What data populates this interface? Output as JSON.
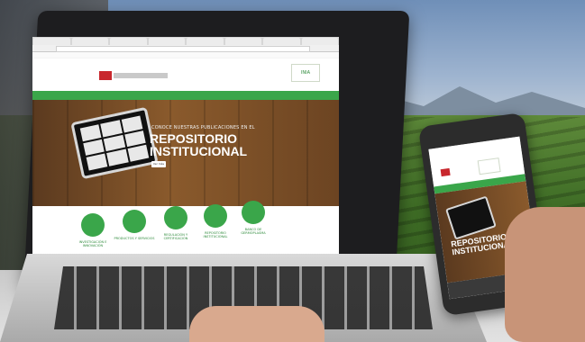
{
  "laptop_site": {
    "hero_kicker": "CONOCE NUESTRAS PUBLICACIONES EN EL",
    "hero_title_line1": "REPOSITORIO",
    "hero_title_line2": "INSTITUCIONAL",
    "hero_button": "Ver más",
    "header_logo_right": "INIA",
    "icons": [
      {
        "label": "INVESTIGACIÓN E INNOVACIÓN"
      },
      {
        "label": "PRODUCTOS Y SERVICIOS"
      },
      {
        "label": "REGULACIÓN Y CERTIFICACIÓN"
      },
      {
        "label": "REPOSITORIO INSTITUCIONAL"
      },
      {
        "label": "BANCO DE GERMOPLASMA"
      }
    ]
  },
  "phone_site": {
    "hero_title_line1": "REPOSITORIO",
    "hero_title_line2": "INSTITUCIONAL"
  },
  "colors": {
    "brand_green": "#3aa64a",
    "brand_red": "#c8272d",
    "wood": "#8a5a2c"
  }
}
